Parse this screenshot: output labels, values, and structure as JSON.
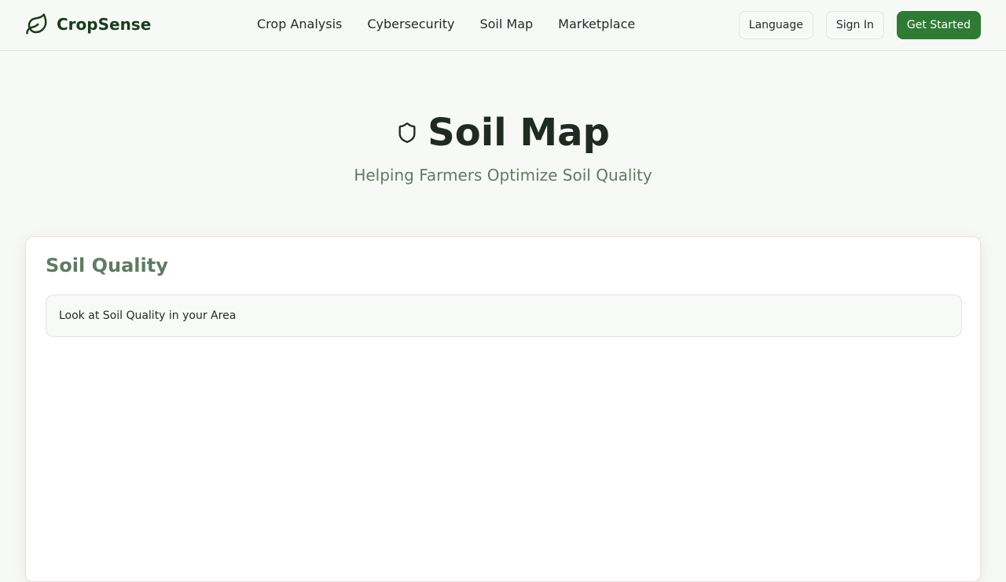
{
  "brand": {
    "name": "CropSense",
    "icon": "leaf-icon",
    "color": "#173d1a"
  },
  "nav": {
    "links": [
      "Crop Analysis",
      "Cybersecurity",
      "Soil Map",
      "Marketplace"
    ]
  },
  "actions": {
    "language": "Language",
    "sign_in": "Sign In",
    "get_started": "Get Started",
    "primary_color": "#2f7a34"
  },
  "hero": {
    "icon": "shield-icon",
    "title": "Soil Map",
    "subtitle": "Helping Farmers Optimize Soil Quality"
  },
  "card": {
    "title": "Soil Quality",
    "info": "Look at Soil Quality in your Area"
  }
}
